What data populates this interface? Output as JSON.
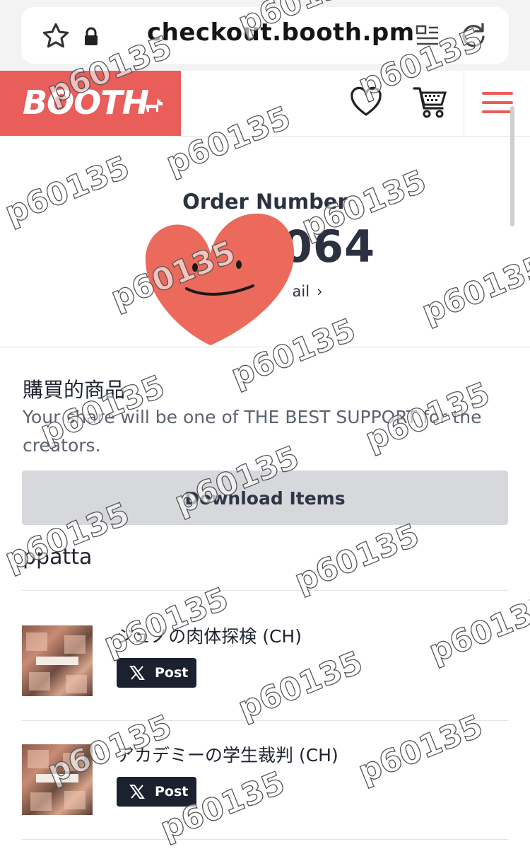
{
  "browser": {
    "url": "checkout.booth.pm"
  },
  "header": {
    "logo": "BOOTH"
  },
  "order": {
    "label": "Order Number",
    "number_visible": "064",
    "detail_link": "ail"
  },
  "purchased": {
    "title": "購買的商品",
    "share_note": "Your share will be one of THE BEST SUPPORT for the creators.",
    "download_label": "Download Items",
    "shop_name": "ppatta",
    "items": [
      {
        "title": "ジュノの肉体探検 (CH)",
        "post_label": "Post"
      },
      {
        "title": "アカデミーの学生裁判 (CH)",
        "post_label": "Post"
      }
    ]
  },
  "watermark": "p60135",
  "colors": {
    "brand": "#e95d5a",
    "post_button": "#1c2130",
    "download_button": "#d6d8dc",
    "heart_sticker": "#ec6a5c"
  }
}
